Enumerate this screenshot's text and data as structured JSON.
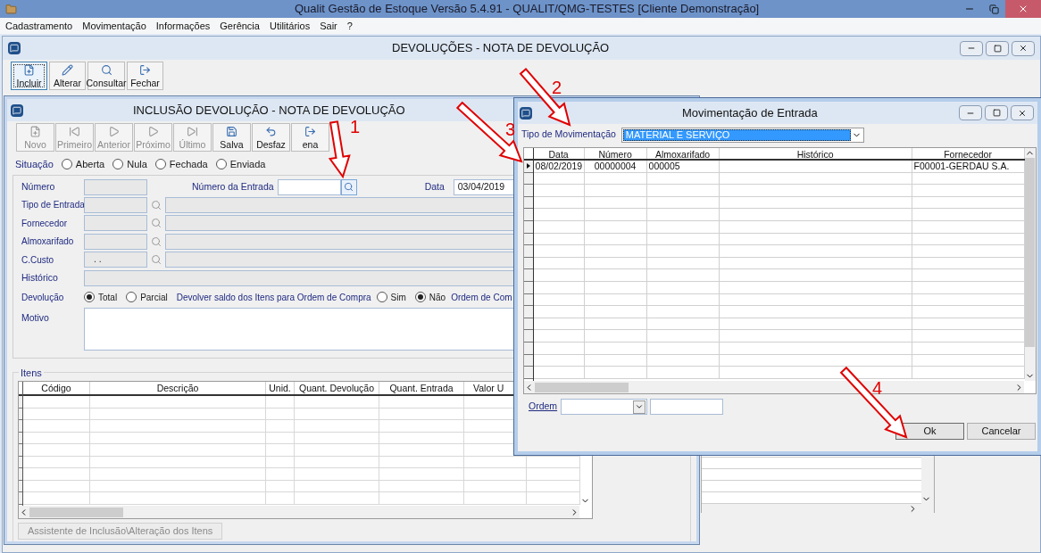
{
  "app": {
    "title": "Qualit Gestão de Estoque Versão 5.4.91 - QUALIT/QMG-TESTES [Cliente Demonstração]",
    "menu": [
      "Cadastramento",
      "Movimentação",
      "Informações",
      "Gerência",
      "Utilitários",
      "Sair",
      "?"
    ]
  },
  "main_window": {
    "title": "DEVOLUÇÕES - NOTA DE DEVOLUÇÃO",
    "toolbar": [
      {
        "kind": "new",
        "label": "Incluir",
        "selected": true
      },
      {
        "kind": "edit",
        "label": "Alterar",
        "selected": false
      },
      {
        "kind": "search",
        "label": "Consultar",
        "selected": false
      },
      {
        "kind": "exit",
        "label": "Fechar",
        "selected": false
      }
    ]
  },
  "form_window": {
    "title": "INCLUSÃO DEVOLUÇÃO - NOTA DE DEVOLUÇÃO",
    "toolbar": [
      {
        "kind": "new",
        "label": "Novo",
        "disabled": true
      },
      {
        "kind": "first",
        "label": "Primeiro",
        "disabled": true
      },
      {
        "kind": "prev",
        "label": "Anterior",
        "disabled": true
      },
      {
        "kind": "next",
        "label": "Próximo",
        "disabled": true
      },
      {
        "kind": "last",
        "label": "Último",
        "disabled": true
      },
      {
        "kind": "save",
        "label": "Salva",
        "disabled": false
      },
      {
        "kind": "undo",
        "label": "Desfaz",
        "disabled": false
      },
      {
        "kind": "exit",
        "label": "ena",
        "disabled": false
      }
    ],
    "situacao": {
      "label": "Situação",
      "options": [
        {
          "label": "Aberta",
          "selected": false
        },
        {
          "label": "Nula",
          "selected": false
        },
        {
          "label": "Fechada",
          "selected": false
        },
        {
          "label": "Enviada",
          "selected": false
        }
      ]
    },
    "numero": {
      "label": "Número",
      "entrada_label": "Número da Entrada",
      "data_label": "Data",
      "data_value": "03/04/2019"
    },
    "lookups": [
      {
        "label": "Tipo de Entrada"
      },
      {
        "label": "Fornecedor"
      },
      {
        "label": "Almoxarifado"
      },
      {
        "label": "C.Custo",
        "value": ". ."
      }
    ],
    "historico": {
      "label": "Histórico"
    },
    "devolucao": {
      "label": "Devolução",
      "options": [
        {
          "label": "Total",
          "selected": true
        },
        {
          "label": "Parcial",
          "selected": false
        }
      ],
      "saldo_label": "Devolver saldo dos Itens para Ordem de Compra",
      "saldo_options": [
        {
          "label": "Sim",
          "selected": false
        },
        {
          "label": "Não",
          "selected": true
        }
      ],
      "ordem_label": "Ordem de Com"
    },
    "motivo": {
      "label": "Motivo"
    },
    "itens": {
      "label": "Itens",
      "columns": [
        "Código",
        "Descrição",
        "Unid.",
        "Quant. Devolução",
        "Quant. Entrada",
        "Valor U"
      ],
      "assistant_button": {
        "label": "Assistente de Inclusão\\Alteração dos Itens",
        "disabled": true
      }
    }
  },
  "dialog": {
    "title": "Movimentação de Entrada",
    "tipo_label": "Tipo de Movimentação",
    "tipo_value": "MATERIAL E SERVIÇO",
    "columns": [
      "Data",
      "Número",
      "Almoxarifado",
      "Histórico",
      "Fornecedor"
    ],
    "rows": [
      {
        "cells": [
          "08/02/2019",
          "00000004",
          "000005",
          null,
          "F00001-GERDAU S.A."
        ],
        "current": true
      }
    ],
    "ordem_label": "Ordem",
    "buttons": [
      {
        "label": "Ok",
        "kind": "default"
      },
      {
        "label": "Cancelar",
        "kind": "normal"
      }
    ]
  },
  "annotations": [
    {
      "label": "1"
    },
    {
      "label": "2"
    },
    {
      "label": "3"
    },
    {
      "label": "4"
    }
  ]
}
